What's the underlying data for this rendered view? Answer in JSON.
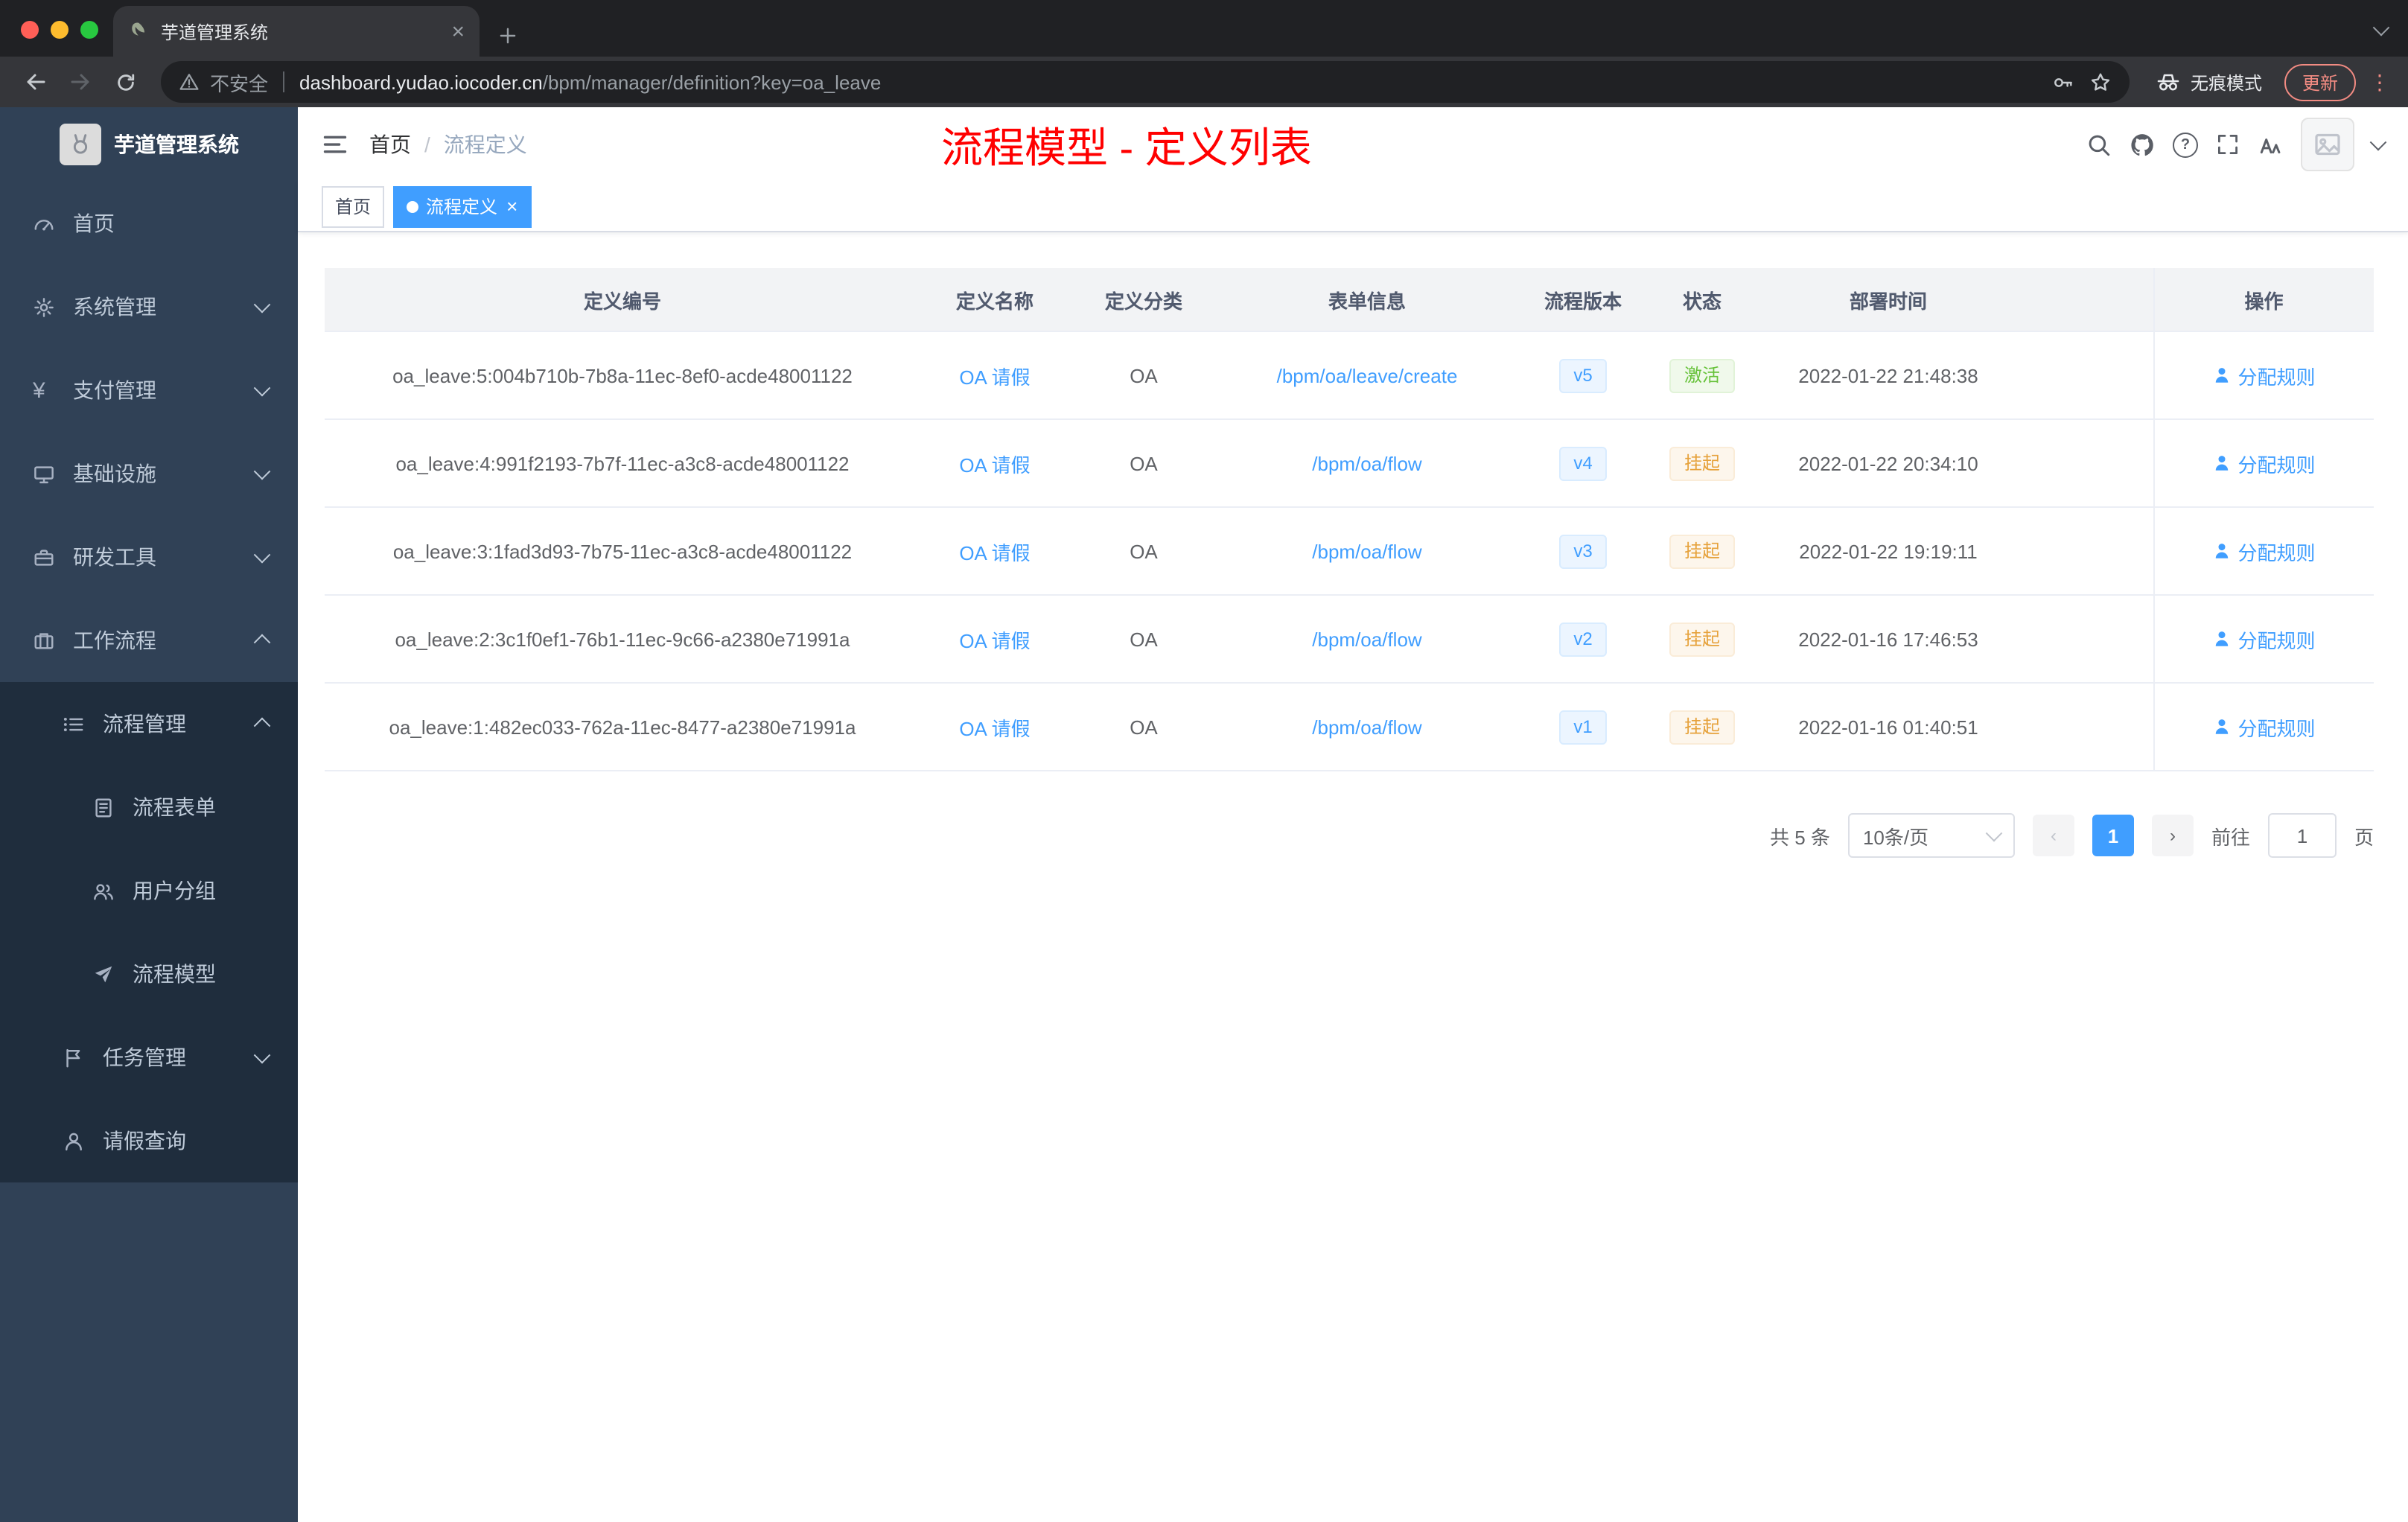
{
  "browser": {
    "tab_title": "芋道管理系统",
    "security_label": "不安全",
    "url_host": "dashboard.yudao.iocoder.cn",
    "url_path": "/bpm/manager/definition?key=oa_leave",
    "incognito_label": "无痕模式",
    "update_label": "更新"
  },
  "sidebar": {
    "logo_title": "芋道管理系统",
    "items": [
      {
        "label": "首页",
        "icon": "dashboard-icon",
        "level": 1
      },
      {
        "label": "系统管理",
        "icon": "gear-icon",
        "level": 1,
        "chevron": "down"
      },
      {
        "label": "支付管理",
        "icon": "yen-icon",
        "level": 1,
        "chevron": "down"
      },
      {
        "label": "基础设施",
        "icon": "monitor-icon",
        "level": 1,
        "chevron": "down"
      },
      {
        "label": "研发工具",
        "icon": "toolbox-icon",
        "level": 1,
        "chevron": "down"
      },
      {
        "label": "工作流程",
        "icon": "briefcase-icon",
        "level": 1,
        "chevron": "up"
      },
      {
        "label": "流程管理",
        "icon": "list-icon",
        "level": 2,
        "chevron": "up"
      },
      {
        "label": "流程表单",
        "icon": "form-icon",
        "level": 3
      },
      {
        "label": "用户分组",
        "icon": "people-icon",
        "level": 3
      },
      {
        "label": "流程模型",
        "icon": "send-icon",
        "level": 3
      },
      {
        "label": "任务管理",
        "icon": "flag-icon",
        "level": 2,
        "chevron": "down"
      },
      {
        "label": "请假查询",
        "icon": "user-icon",
        "level": 2
      }
    ]
  },
  "header": {
    "breadcrumb": {
      "home": "首页",
      "separator": "/",
      "current": "流程定义"
    },
    "annotation": "流程模型 - 定义列表"
  },
  "tags": {
    "home": "首页",
    "active": "流程定义"
  },
  "table": {
    "columns": [
      "定义编号",
      "定义名称",
      "定义分类",
      "表单信息",
      "流程版本",
      "状态",
      "部署时间",
      "操作"
    ],
    "rows": [
      {
        "id": "oa_leave:5:004b710b-7b8a-11ec-8ef0-acde48001122",
        "name": "OA 请假",
        "category": "OA",
        "form": "/bpm/oa/leave/create",
        "version": "v5",
        "status": "激活",
        "status_class": "pill-success",
        "time": "2022-01-22 21:48:38",
        "action": "分配规则"
      },
      {
        "id": "oa_leave:4:991f2193-7b7f-11ec-a3c8-acde48001122",
        "name": "OA 请假",
        "category": "OA",
        "form": "/bpm/oa/flow",
        "version": "v4",
        "status": "挂起",
        "status_class": "pill-warning",
        "time": "2022-01-22 20:34:10",
        "action": "分配规则"
      },
      {
        "id": "oa_leave:3:1fad3d93-7b75-11ec-a3c8-acde48001122",
        "name": "OA 请假",
        "category": "OA",
        "form": "/bpm/oa/flow",
        "version": "v3",
        "status": "挂起",
        "status_class": "pill-warning",
        "time": "2022-01-22 19:19:11",
        "action": "分配规则"
      },
      {
        "id": "oa_leave:2:3c1f0ef1-76b1-11ec-9c66-a2380e71991a",
        "name": "OA 请假",
        "category": "OA",
        "form": "/bpm/oa/flow",
        "version": "v2",
        "status": "挂起",
        "status_class": "pill-warning",
        "time": "2022-01-16 17:46:53",
        "action": "分配规则"
      },
      {
        "id": "oa_leave:1:482ec033-762a-11ec-8477-a2380e71991a",
        "name": "OA 请假",
        "category": "OA",
        "form": "/bpm/oa/flow",
        "version": "v1",
        "status": "挂起",
        "status_class": "pill-warning",
        "time": "2022-01-16 01:40:51",
        "action": "分配规则"
      }
    ]
  },
  "pagination": {
    "total": "共 5 条",
    "page_size": "10条/页",
    "current_page": "1",
    "goto_label": "前往",
    "goto_value": "1",
    "page_unit": "页"
  },
  "colors": {
    "accent": "#409eff",
    "success": "#67c23a",
    "warning": "#e6a23c",
    "sidebar_bg": "#304156",
    "submenu_bg": "#1f2d3d",
    "annotation": "#ff0000",
    "update": "#f28b82"
  }
}
